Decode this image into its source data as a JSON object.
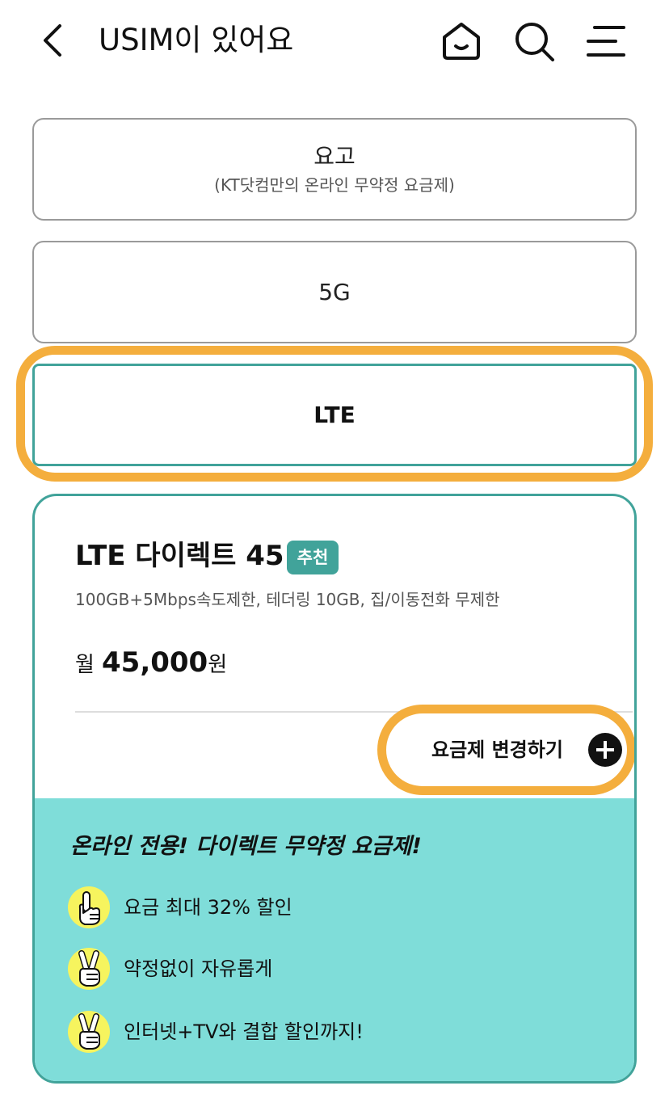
{
  "header": {
    "title": "USIM이 있어요",
    "back_icon": "chevron-left-icon",
    "home_icon": "home-icon",
    "search_icon": "search-icon",
    "menu_icon": "hamburger-menu-icon"
  },
  "options": [
    {
      "label": "요고",
      "sublabel": "(KT닷컴만의 온라인 무약정 요금제)"
    },
    {
      "label": "5G",
      "sublabel": ""
    },
    {
      "label": "LTE",
      "sublabel": "",
      "selected": true
    }
  ],
  "plan": {
    "name": "LTE 다이렉트 45",
    "badge": "추천",
    "description": "100GB+5Mbps속도제한, 테더링 10GB, 집/이동전화 무제한",
    "price_prefix": "월",
    "price_value": "45,000",
    "price_unit": "원",
    "change_button": "요금제 변경하기"
  },
  "benefits": {
    "title": "온라인 전용! 다이렉트 무약정 요금제!",
    "items": [
      {
        "text": "요금 최대 32% 할인",
        "icon": "one-finger-hand-icon"
      },
      {
        "text": "약정없이 자유롭게",
        "icon": "peace-sign-hand-icon"
      },
      {
        "text": "인터넷+TV와 결합 할인까지!",
        "icon": "peace-sign-hand-icon"
      }
    ]
  },
  "colors": {
    "accent": "#41a39a",
    "highlight": "#f4ae3d",
    "benefit_bg": "#7fddd9",
    "hand_icon_bg": "#f6f45e"
  }
}
